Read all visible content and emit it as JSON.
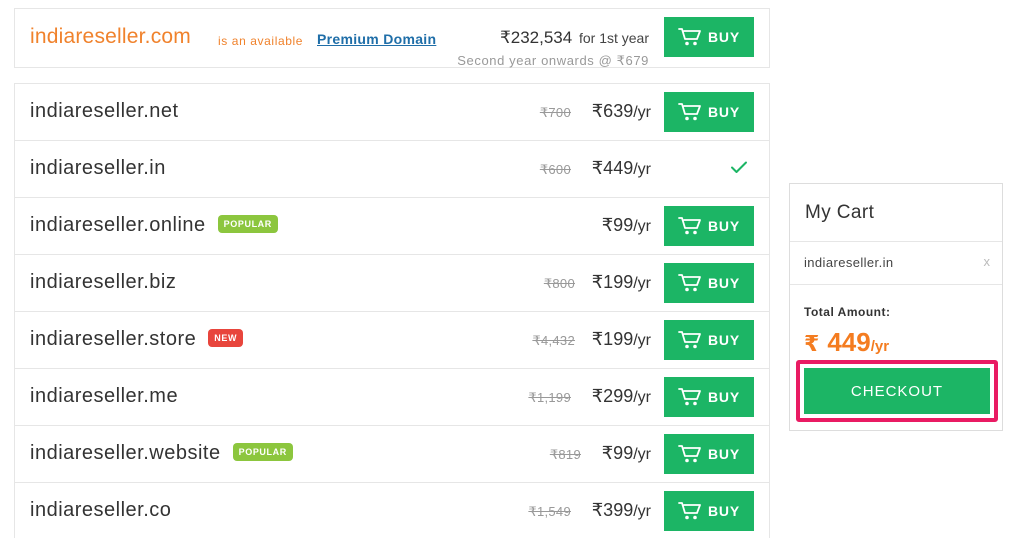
{
  "premium": {
    "domain": "indiareseller.com",
    "available_text": "is an available",
    "link_text": "Premium Domain",
    "price": "₹232,534",
    "price_suffix": "for 1st year",
    "renewal_text": "Second year onwards @ ₹679",
    "buy_label": "BUY"
  },
  "domains": [
    {
      "name": "indiareseller.net",
      "old_price": "₹700",
      "price": "₹639",
      "per": "/yr",
      "buy_label": "BUY",
      "in_cart": false
    },
    {
      "name": "indiareseller.in",
      "old_price": "₹600",
      "price": "₹449",
      "per": "/yr",
      "buy_label": "",
      "in_cart": true
    },
    {
      "name": "indiareseller.online",
      "badge": "POPULAR",
      "old_price": "",
      "price": "₹99",
      "per": "/yr",
      "buy_label": "BUY",
      "in_cart": false
    },
    {
      "name": "indiareseller.biz",
      "old_price": "₹800",
      "price": "₹199",
      "per": "/yr",
      "buy_label": "BUY",
      "in_cart": false
    },
    {
      "name": "indiareseller.store",
      "badge": "NEW",
      "old_price": "₹4,432",
      "price": "₹199",
      "per": "/yr",
      "buy_label": "BUY",
      "in_cart": false
    },
    {
      "name": "indiareseller.me",
      "old_price": "₹1,199",
      "price": "₹299",
      "per": "/yr",
      "buy_label": "BUY",
      "in_cart": false
    },
    {
      "name": "indiareseller.website",
      "badge": "POPULAR",
      "old_price": "₹819",
      "price": "₹99",
      "per": "/yr",
      "buy_label": "BUY",
      "in_cart": false
    },
    {
      "name": "indiareseller.co",
      "old_price": "₹1,549",
      "price": "₹399",
      "per": "/yr",
      "buy_label": "BUY",
      "in_cart": false
    }
  ],
  "cart": {
    "title": "My Cart",
    "item": "indiareseller.in",
    "remove_icon": "x",
    "total_label": "Total Amount:",
    "currency": "₹",
    "amount": "449",
    "per": "/yr",
    "checkout_label": "CHECKOUT"
  },
  "colors": {
    "accent_orange": "#f0822c",
    "buy_green": "#1cb565",
    "popular_badge": "#8cc63e",
    "new_badge": "#e8453c",
    "highlight": "#e91b63",
    "link_blue": "#1f6ea8"
  },
  "icons": {
    "buy": "cart-icon",
    "added": "check-icon",
    "remove": "close-icon"
  }
}
